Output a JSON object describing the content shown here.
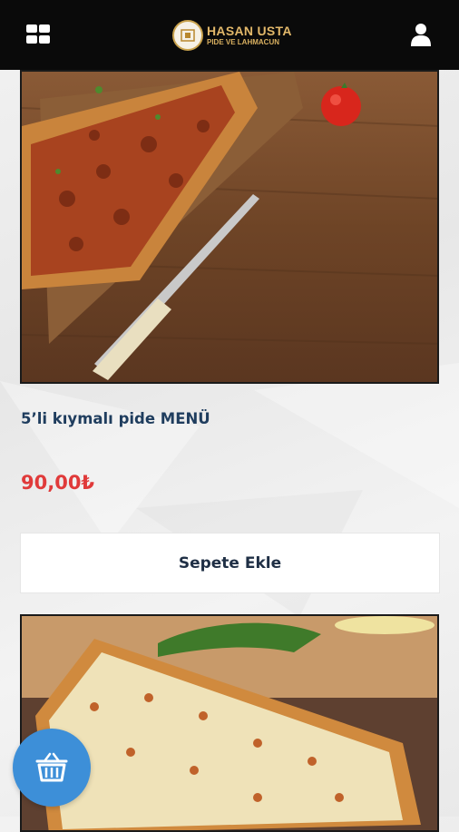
{
  "header": {
    "logo_title": "HASAN USTA",
    "logo_subtitle": "PIDE VE LAHMACUN",
    "menu_icon": "grid-icon",
    "user_icon": "user-icon"
  },
  "products": [
    {
      "name": "5’li kıymalı pide MENÜ",
      "price": "90,00₺",
      "add_label": "Sepete Ekle",
      "image": "kiymali-pide-photo"
    },
    {
      "image": "kasarli-pide-photo"
    }
  ],
  "cart": {
    "icon": "basket-icon"
  },
  "colors": {
    "header_bg": "#0a0a0a",
    "title": "#1f3d5e",
    "price": "#e03a3a",
    "cart_fab": "#3d8fd8"
  }
}
